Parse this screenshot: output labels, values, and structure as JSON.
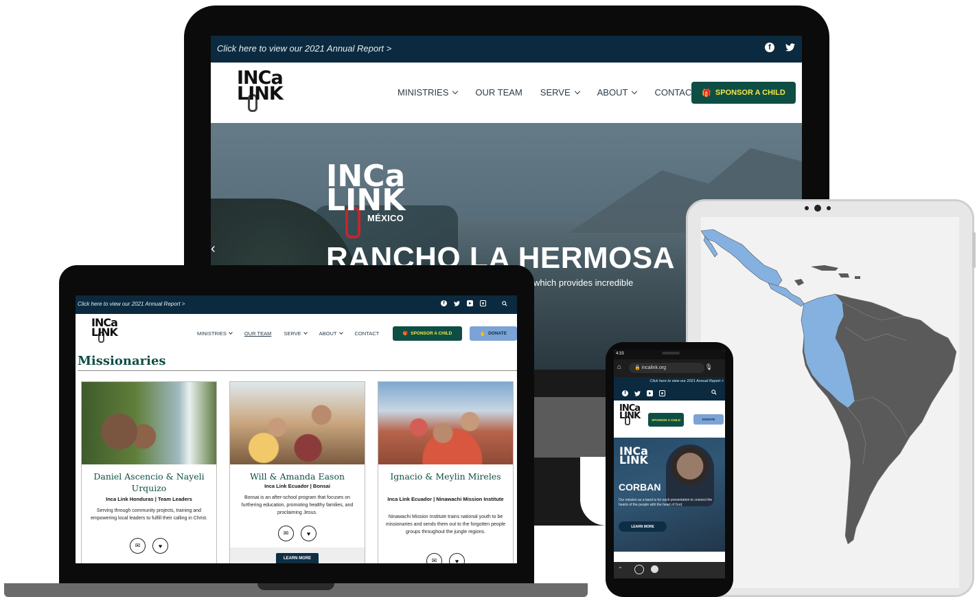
{
  "desktop": {
    "announcement": "Click here to view our 2021 Annual Report >",
    "logo": {
      "line1": "INCa",
      "line2": "LINK"
    },
    "menu": [
      {
        "label": "MINISTRIES",
        "dropdown": true
      },
      {
        "label": "OUR TEAM",
        "dropdown": false
      },
      {
        "label": "SERVE",
        "dropdown": true
      },
      {
        "label": "ABOUT",
        "dropdown": true
      },
      {
        "label": "CONTACT",
        "dropdown": false
      }
    ],
    "cta": "SPONSOR A CHILD",
    "hero": {
      "logo_line1": "INCa",
      "logo_line2": "LINK",
      "region": "MÉXICO",
      "title": "RANCHO LA HERMOSA",
      "subtitle": "which provides incredible"
    }
  },
  "laptop": {
    "announcement": "Click here to view our 2021 Annual Report >",
    "menu": [
      {
        "label": "MINISTRIES",
        "dropdown": true
      },
      {
        "label": "OUR TEAM",
        "dropdown": false
      },
      {
        "label": "SERVE",
        "dropdown": true
      },
      {
        "label": "ABOUT",
        "dropdown": true
      },
      {
        "label": "CONTACT",
        "dropdown": false
      }
    ],
    "cta": "SPONSOR A CHILD",
    "donate": "DONATE",
    "heading": "Missionaries",
    "cards": [
      {
        "name": "Daniel Ascencio & Nayeli Urquizo",
        "role": "Inca Link Honduras | Team Leaders",
        "desc": "Serving through community projects, training and empowering local leaders to fulfill their calling in Christ."
      },
      {
        "name": "Will & Amanda Eason",
        "role": "Inca Link Ecuador | Bonsai",
        "desc": "Bonsai is an after-school program that focuses on furthering education, promoting healthy families, and proclaiming Jesus.",
        "learn_more": "LEARN MORE"
      },
      {
        "name": "Ignacio & Meylin Mireles",
        "role": "Inca Link Ecuador | Ninawachi Mission Institute",
        "desc": "Ninawachi Mission Institute trains national youth to be missionaries and sends them out to the forgotten people groups throughout the jungle regions."
      }
    ]
  },
  "phone": {
    "time": "4:33",
    "url": "incalink.org",
    "announcement": "Click here to view our 2021 Annual Report >",
    "cta": "SPONSOR A CHILD",
    "donate": "DONATE",
    "hero": {
      "title": "CORBAN",
      "text": "Our mission as a band is for each presentation to connect the hearts of the people with the heart of God.",
      "learn_more": "LEARN MORE"
    }
  },
  "colors": {
    "topbar": "#0b2a3f",
    "brand_green": "#0e4e45",
    "cta_text": "#f6e84a",
    "donate_blue": "#7ca3d6",
    "map_highlight": "#84b1e0",
    "map_land": "#5a5a5a"
  }
}
